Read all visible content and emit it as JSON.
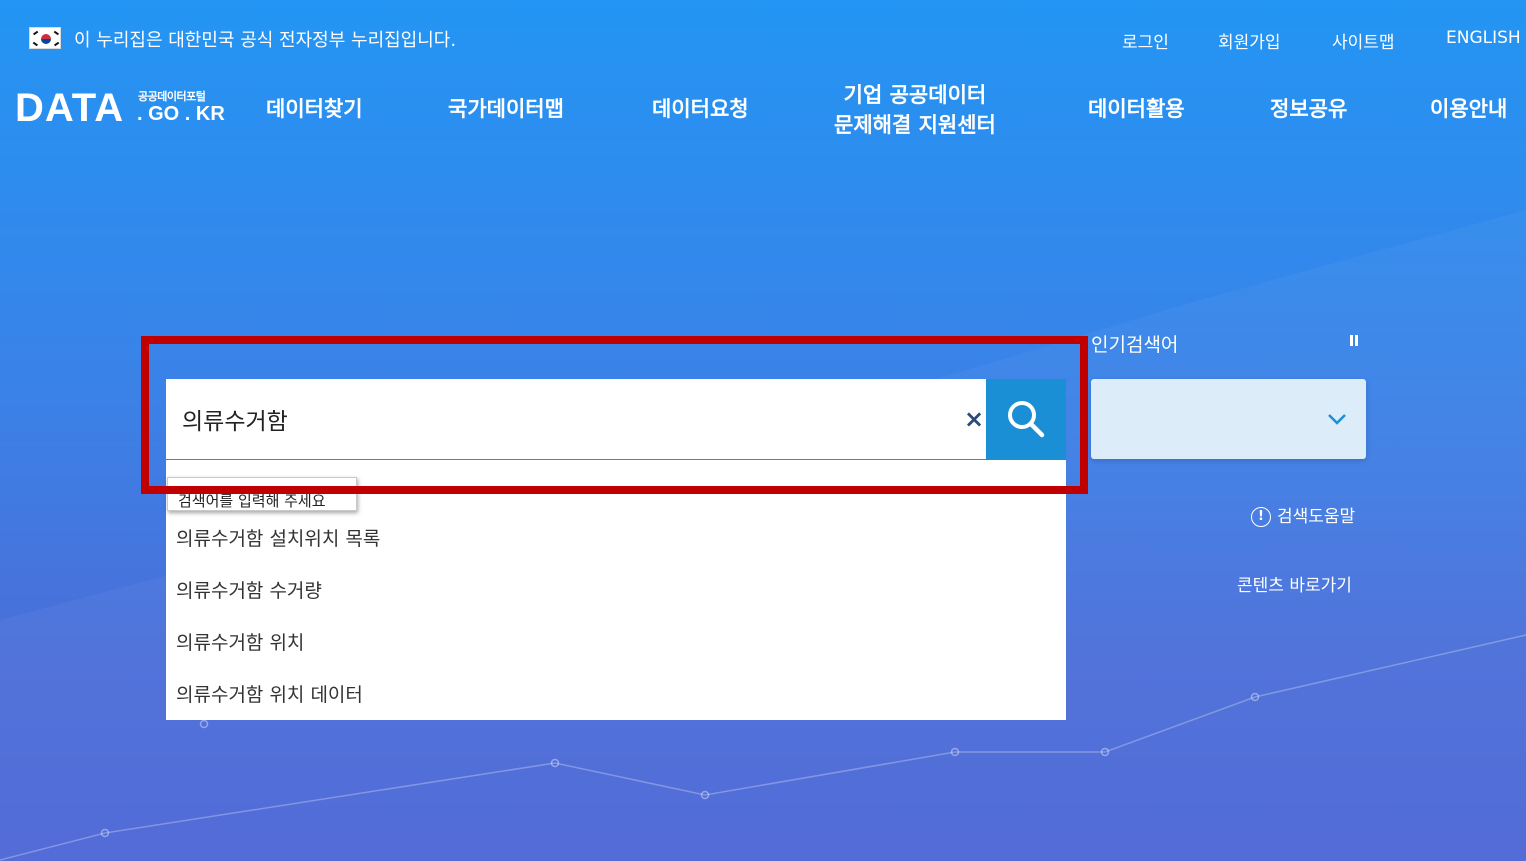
{
  "gov_bar": {
    "notice": "이 누리집은 대한민국 공식 전자정부 누리집입니다.",
    "flag_icon": "korea-flag-icon"
  },
  "util_links": [
    {
      "label": "로그인"
    },
    {
      "label": "회원가입"
    },
    {
      "label": "사이트맵"
    },
    {
      "label": "ENGLISH"
    }
  ],
  "logo": {
    "main": "DATA",
    "sub": "공공데이터포털",
    "domain": ". GO . KR"
  },
  "nav": [
    {
      "label": "데이터찾기"
    },
    {
      "label": "국가데이터맵"
    },
    {
      "label": "데이터요청"
    },
    {
      "label_line1": "기업 공공데이터",
      "label_line2": "문제해결 지원센터"
    },
    {
      "label": "데이터활용"
    },
    {
      "label": "정보공유"
    },
    {
      "label": "이용안내"
    }
  ],
  "search": {
    "value": "의류수거함",
    "placeholder": "검색어를 입력해 주세요",
    "tooltip": "검색어를 입력해 주세요",
    "clear_glyph": "×",
    "search_icon": "search-icon"
  },
  "suggestions": [
    {
      "text": "의류수거함 설치위치 목록"
    },
    {
      "text": "의류수거함 수거량"
    },
    {
      "text": "의류수거함 위치"
    },
    {
      "text": "의류수거함 위치 데이터"
    }
  ],
  "popular": {
    "title": "인기검색어",
    "pause_icon": "pause-icon",
    "dropdown_icon": "chevron-down-icon"
  },
  "links": {
    "help": "검색도움말",
    "help_glyph": "!",
    "content_shortcut": "콘텐츠 바로가기"
  },
  "colors": {
    "accent": "#1a8fd6",
    "highlight": "#c00000",
    "bg_top": "#2395f3",
    "bg_bottom": "#4c66d6"
  }
}
